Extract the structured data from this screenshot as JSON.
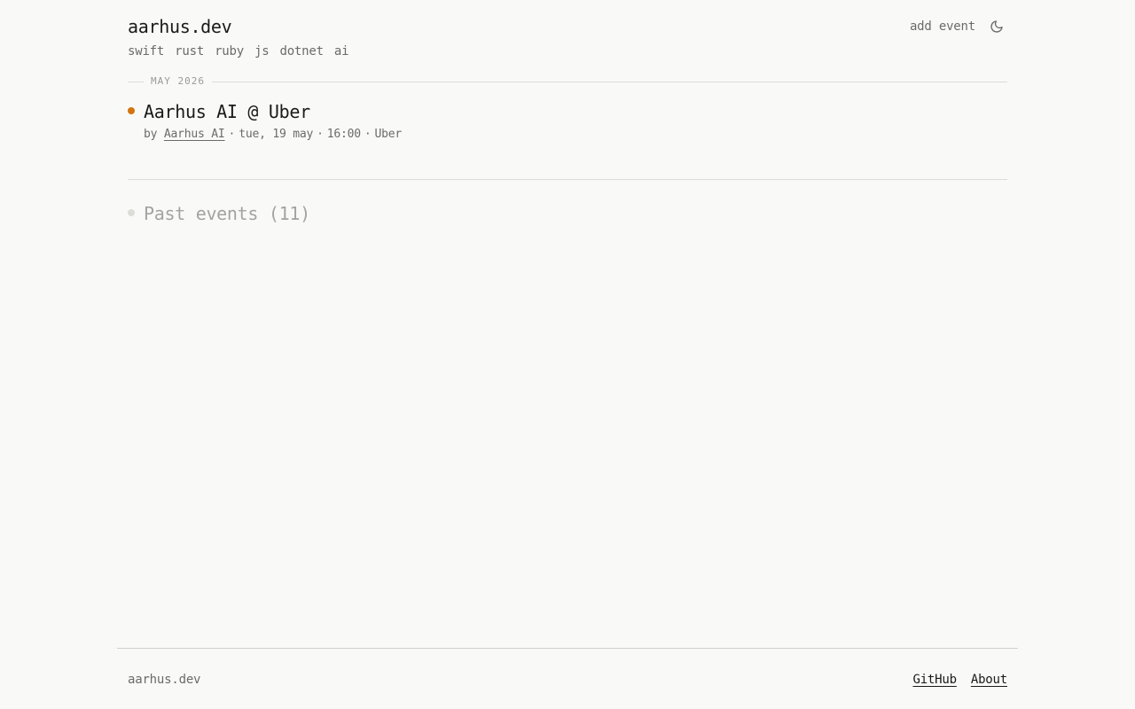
{
  "header": {
    "site_title": "aarhus.dev",
    "tags": [
      "swift",
      "rust",
      "ruby",
      "js",
      "dotnet",
      "ai"
    ],
    "add_event_label": "add event",
    "theme_icon": "moon-icon"
  },
  "month_section": {
    "label": "MAY 2026"
  },
  "event": {
    "title": "Aarhus AI @ Uber",
    "by_prefix": "by",
    "organizer": "Aarhus AI",
    "date": "tue, 19 may",
    "time": "16:00",
    "venue": "Uber",
    "separator": "·",
    "dot_color": "#d2740f"
  },
  "past_events": {
    "label": "Past events (11)"
  },
  "footer": {
    "site_name": "aarhus.dev",
    "links": [
      "GitHub",
      "About"
    ]
  }
}
